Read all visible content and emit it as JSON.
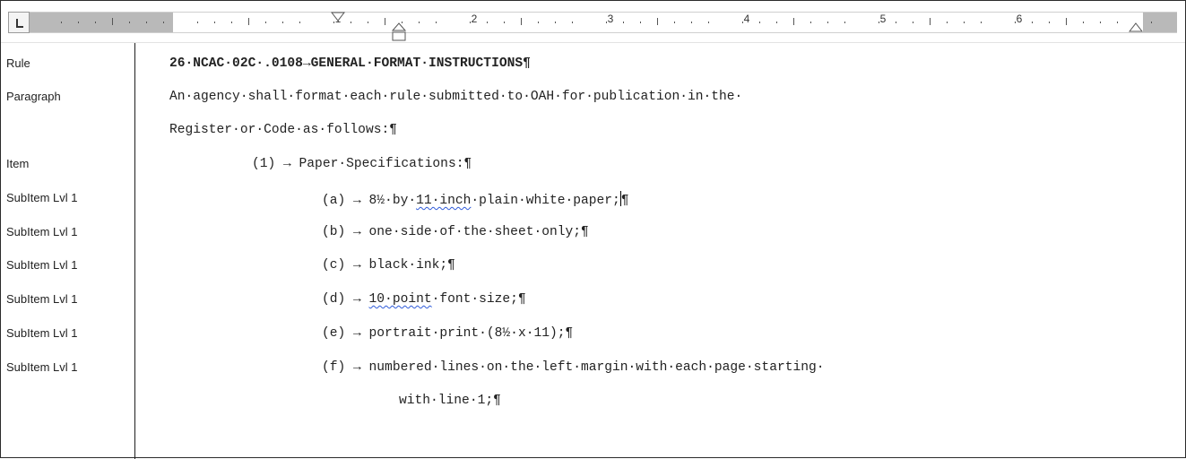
{
  "ruler": {
    "numbers": [
      "1",
      "2",
      "3",
      "4",
      "5",
      "6"
    ]
  },
  "styles": [
    "Rule",
    "Paragraph",
    "Item",
    "SubItem Lvl 1",
    "SubItem Lvl 1",
    "SubItem Lvl 1",
    "SubItem Lvl 1",
    "SubItem Lvl 1",
    "SubItem Lvl 1"
  ],
  "document": {
    "heading": "26·NCAC·02C·.0108→GENERAL·FORMAT·INSTRUCTIONS¶",
    "para_line1": "An·agency·shall·format·each·rule·submitted·to·OAH·for·publication·in·the·",
    "para_line2": "Register·or·Code·as·follows:¶",
    "item1": "(1) → Paper·Specifications:¶",
    "sub_a_prefix": "(a) → 8½·by·",
    "sub_a_squiggle": "11·inch",
    "sub_a_suffix": "·plain·white·paper;",
    "sub_a_pilcrow": "¶",
    "sub_b": "(b) → one·side·of·the·sheet·only;¶",
    "sub_c": "(c) → black·ink;¶",
    "sub_d_prefix": "(d) → ",
    "sub_d_squiggle": "10·point",
    "sub_d_suffix": "·font·size;¶",
    "sub_e": "(e) → portrait·print·(8½·x·11);¶",
    "sub_f_line1": "(f) → numbered·lines·on·the·left·margin·with·each·page·starting·",
    "sub_f_line2": "with·line·1;¶"
  }
}
